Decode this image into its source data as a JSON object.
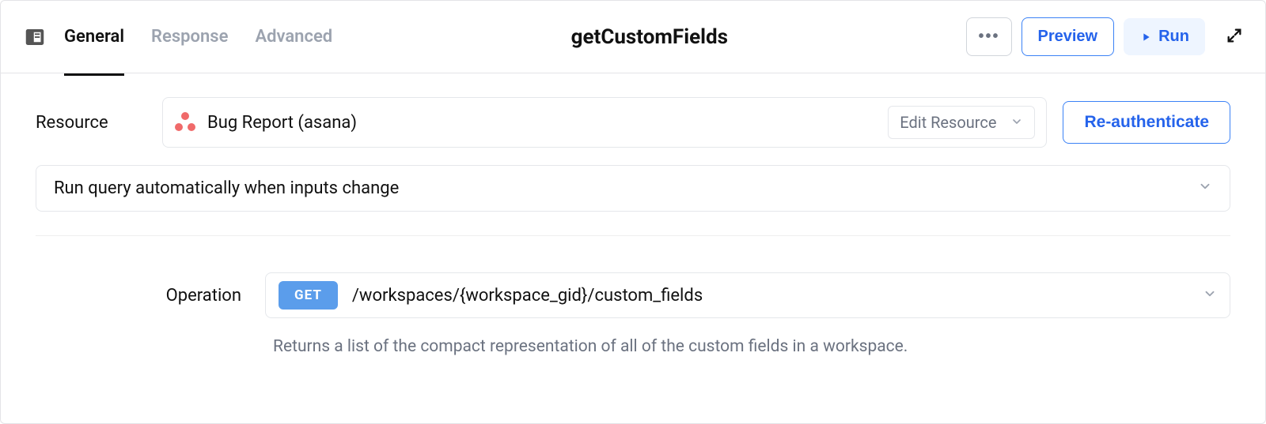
{
  "header": {
    "tabs": {
      "general": "General",
      "response": "Response",
      "advanced": "Advanced"
    },
    "title": "getCustomFields",
    "actions": {
      "preview": "Preview",
      "run": "Run"
    }
  },
  "resource": {
    "label": "Resource",
    "name": "Bug Report (asana)",
    "edit_label": "Edit Resource",
    "reauth_label": "Re-authenticate"
  },
  "run_mode": {
    "label": "Run query automatically when inputs change"
  },
  "operation": {
    "label": "Operation",
    "method": "GET",
    "path": "/workspaces/{workspace_gid}/custom_fields",
    "description": "Returns a list of the compact representation of all of the custom fields in a workspace."
  }
}
